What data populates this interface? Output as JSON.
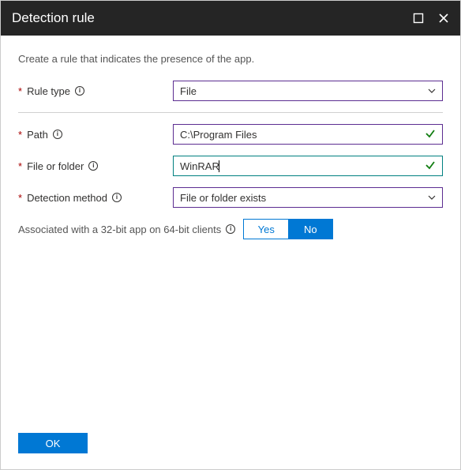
{
  "header": {
    "title": "Detection rule"
  },
  "description": "Create a rule that indicates the presence of the app.",
  "form": {
    "ruleType": {
      "label": "Rule type",
      "value": "File"
    },
    "path": {
      "label": "Path",
      "value": "C:\\Program Files"
    },
    "fileOrFolder": {
      "label": "File or folder",
      "value": "WinRAR"
    },
    "detectionMethod": {
      "label": "Detection method",
      "value": "File or folder exists"
    },
    "associated32": {
      "label": "Associated with a 32-bit app on 64-bit clients",
      "yes": "Yes",
      "no": "No",
      "selected": "No"
    }
  },
  "buttons": {
    "ok": "OK"
  }
}
